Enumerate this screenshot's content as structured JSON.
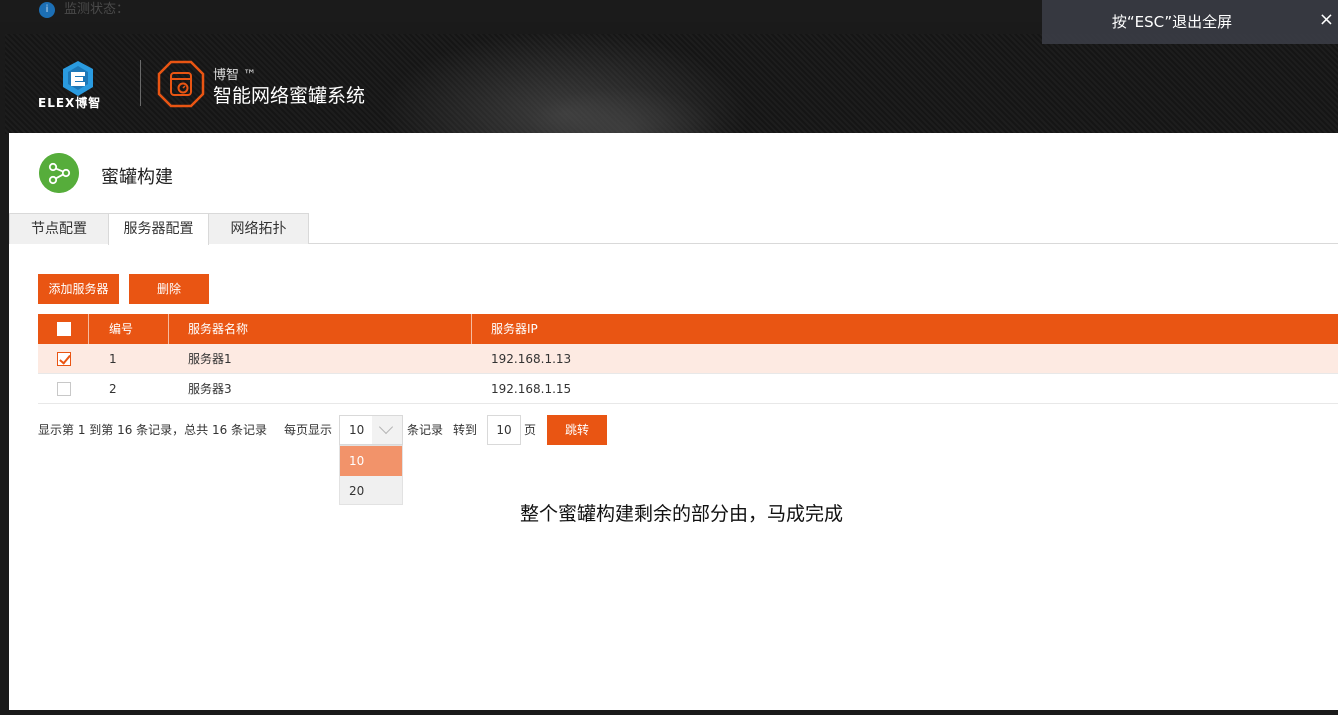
{
  "status_bar": {
    "label": "监测状态："
  },
  "fullscreen_notice": {
    "text": "按“ESC”退出全屏",
    "close": "×"
  },
  "header": {
    "logo_text": "ELEX博智",
    "product_brand": "博智 ™",
    "product_name": "智能网络蜜罐系统"
  },
  "page": {
    "title": "蜜罐构建"
  },
  "tabs": [
    {
      "label": "节点配置",
      "active": false
    },
    {
      "label": "服务器配置",
      "active": true
    },
    {
      "label": "网络拓扑",
      "active": false
    }
  ],
  "toolbar": {
    "add_label": "添加服务器",
    "delete_label": "删除"
  },
  "table": {
    "headers": {
      "id": "编号",
      "name": "服务器名称",
      "ip": "服务器IP"
    },
    "rows": [
      {
        "id": "1",
        "name": "服务器1",
        "ip": "192.168.1.13",
        "checked": true
      },
      {
        "id": "2",
        "name": "服务器3",
        "ip": "192.168.1.15",
        "checked": false
      }
    ]
  },
  "pagination": {
    "summary": "显示第 1 到第 16 条记录，总共 16 条记录",
    "per_page_label": "每页显示",
    "page_size": "10",
    "records_label": "条记录",
    "goto_label": "转到",
    "goto_value": "10",
    "page_unit": "页",
    "jump_label": "跳转",
    "options": [
      "10",
      "20"
    ]
  },
  "note": "整个蜜罐构建剩余的部分由，马成完成",
  "colors": {
    "accent": "#e95513",
    "selected_row": "#fdeae2",
    "icon_green": "#56ad3b",
    "logo_blue": "#2a9be0"
  }
}
